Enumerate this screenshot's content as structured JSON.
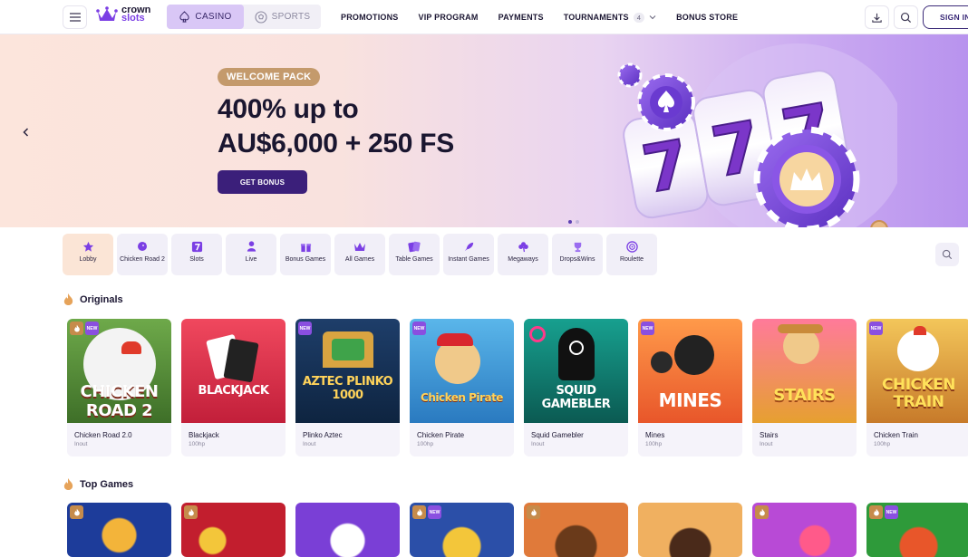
{
  "header": {
    "logo_line1": "crown",
    "logo_line2": "slots",
    "mode_tabs": [
      {
        "label": "CASINO",
        "icon": "spade-icon",
        "active": true
      },
      {
        "label": "SPORTS",
        "icon": "football-icon",
        "active": false
      }
    ],
    "nav": [
      {
        "label": "PROMOTIONS"
      },
      {
        "label": "VIP PROGRAM"
      },
      {
        "label": "PAYMENTS"
      },
      {
        "label": "TOURNAMENTS",
        "badge": "4"
      },
      {
        "label": "BONUS STORE"
      }
    ],
    "signin_label": "SIGN IN"
  },
  "hero": {
    "badge": "WELCOME PACK",
    "title_line1": "400% up to",
    "title_line2": "AU$6,000 + 250 FS",
    "cta": "GET BONUS",
    "slides_total": 2,
    "slide_active": 1
  },
  "categories": [
    {
      "label": "Lobby",
      "icon": "star-icon",
      "active": true
    },
    {
      "label": "Chicken Road 2",
      "icon": "chicken-icon"
    },
    {
      "label": "Slots",
      "icon": "seven-icon"
    },
    {
      "label": "Live",
      "icon": "dealer-icon"
    },
    {
      "label": "Bonus Games",
      "icon": "gift-icon"
    },
    {
      "label": "All Games",
      "icon": "crown-icon"
    },
    {
      "label": "Table Games",
      "icon": "cards-icon"
    },
    {
      "label": "Instant Games",
      "icon": "rocket-icon"
    },
    {
      "label": "Megaways",
      "icon": "clover-icon"
    },
    {
      "label": "Drops&Wins",
      "icon": "trophy-icon"
    },
    {
      "label": "Roulette",
      "icon": "roulette-icon"
    }
  ],
  "originals": {
    "title": "Originals",
    "games": [
      {
        "name": "Chicken Road 2.0",
        "provider": "Inout",
        "art_text": "CHICKEN ROAD 2",
        "bg": "#4f7f33",
        "fire": true,
        "new": true
      },
      {
        "name": "Blackjack",
        "provider": "100hp",
        "art_text": "BLACKJACK",
        "bg": "#e0304a"
      },
      {
        "name": "Plinko Aztec",
        "provider": "Inout",
        "art_text": "AZTEC PLINKO 1000",
        "bg": "#2e5a8a",
        "new": true
      },
      {
        "name": "Chicken Pirate",
        "provider": "100hp",
        "art_text": "Chicken Pirate",
        "bg": "#3a8fd1",
        "new": true
      },
      {
        "name": "Squid Gamebler",
        "provider": "Inout",
        "art_text": "SQUID GAMEBLER",
        "bg": "#0f7a6e"
      },
      {
        "name": "Mines",
        "provider": "100hp",
        "art_text": "MINES",
        "bg": "#f47a3a",
        "new": true
      },
      {
        "name": "Stairs",
        "provider": "Inout",
        "art_text": "STAIRS",
        "bg": "#e85a7a"
      },
      {
        "name": "Chicken Train",
        "provider": "100hp",
        "art_text": "CHICKEN TRAIN",
        "bg": "#e3a93a",
        "new": true
      }
    ]
  },
  "top_games": {
    "title": "Top Games",
    "games": [
      {
        "bg": "#1d3c9a",
        "fire": true
      },
      {
        "bg": "#c21e2e",
        "fire": true
      },
      {
        "bg": "#7a3fd6"
      },
      {
        "bg": "#2b4fa8",
        "fire": true,
        "new": true
      },
      {
        "bg": "#e07a3a",
        "fire": true
      },
      {
        "bg": "#e89a4a"
      },
      {
        "bg": "#b84ad6",
        "fire": true
      },
      {
        "bg": "#2e9a3a",
        "fire": true,
        "new": true
      }
    ]
  }
}
